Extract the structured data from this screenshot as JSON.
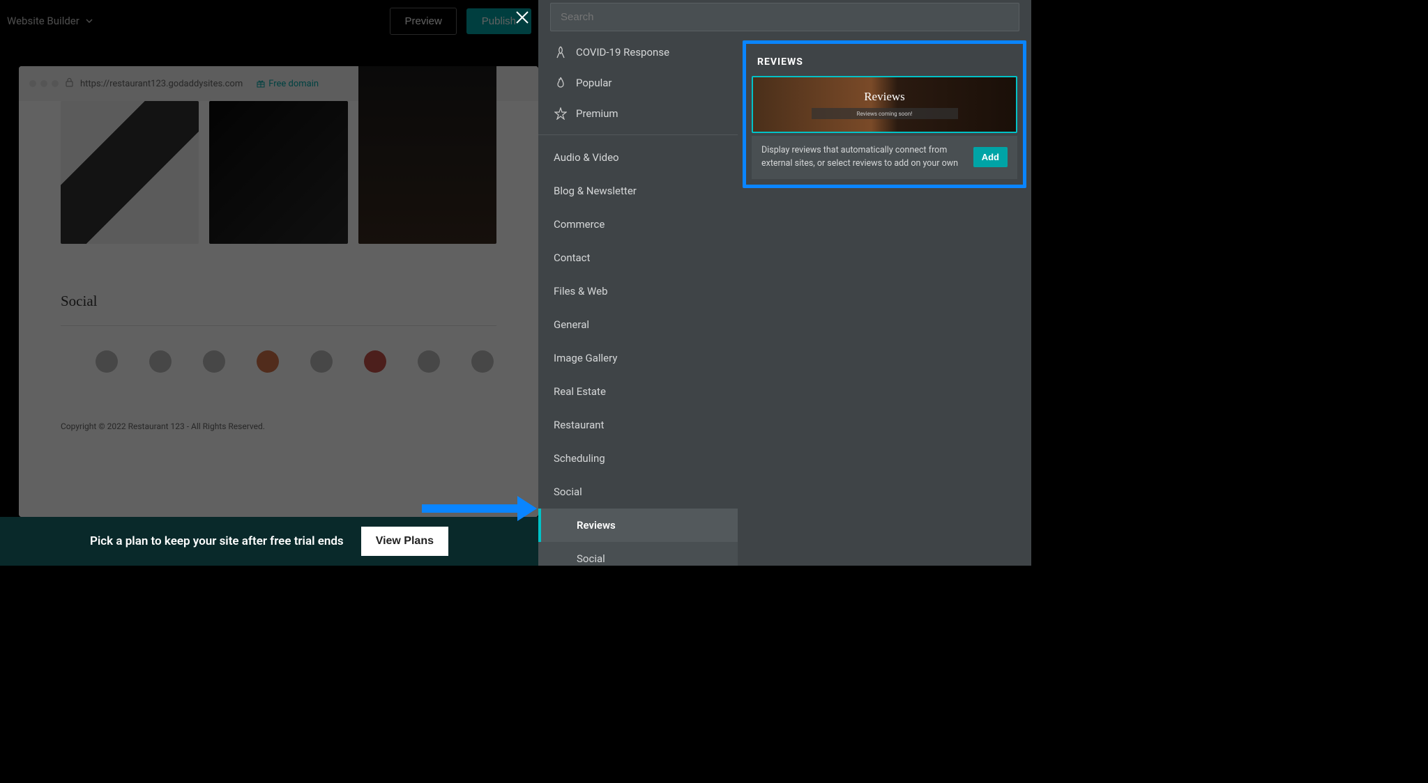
{
  "header": {
    "title": "Website Builder",
    "preview": "Preview",
    "publish": "Publish"
  },
  "preview": {
    "url": "https://restaurant123.godaddysites.com",
    "free_domain": "Free domain",
    "social_heading": "Social",
    "copyright": "Copyright © 2022 Restaurant 123 - All Rights Reserved."
  },
  "trial": {
    "text": "Pick a plan to keep your site after free trial ends",
    "button": "View Plans"
  },
  "search": {
    "placeholder": "Search"
  },
  "categories": {
    "top": [
      {
        "label": "COVID-19 Response",
        "icon": "ribbon"
      },
      {
        "label": "Popular",
        "icon": "flame"
      },
      {
        "label": "Premium",
        "icon": "star"
      }
    ],
    "list": [
      "Audio & Video",
      "Blog & Newsletter",
      "Commerce",
      "Contact",
      "Files & Web",
      "General",
      "Image Gallery",
      "Real Estate",
      "Restaurant",
      "Scheduling",
      "Social"
    ],
    "sub": [
      {
        "label": "Reviews",
        "active": true
      },
      {
        "label": "Social",
        "active": false
      }
    ]
  },
  "detail": {
    "heading": "REVIEWS",
    "card_title": "Reviews",
    "card_subtitle": "Reviews coming soon!",
    "description": "Display reviews that automatically connect from external sites, or select reviews to add on your own",
    "add": "Add"
  }
}
